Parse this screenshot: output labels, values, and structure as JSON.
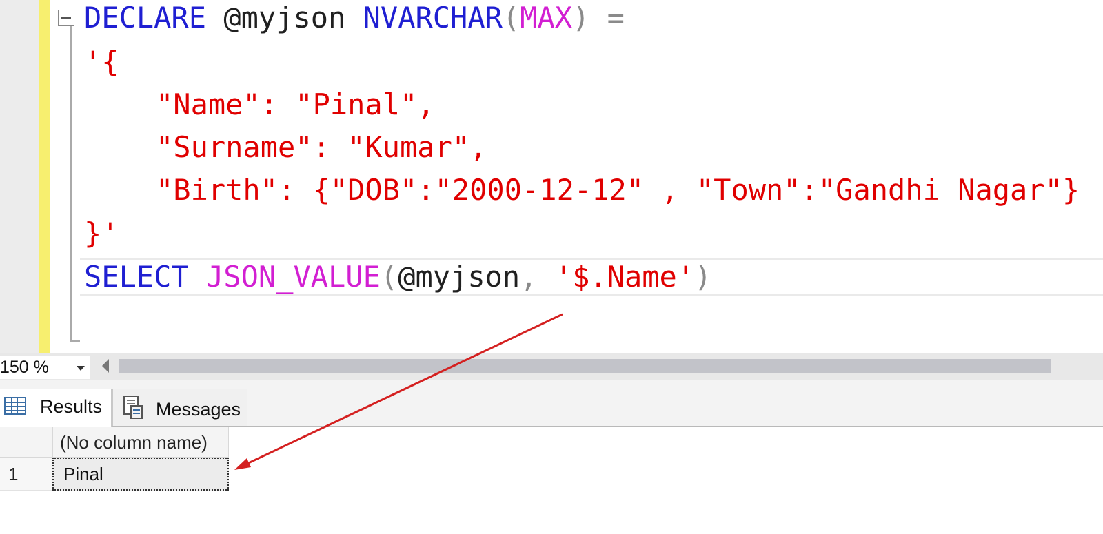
{
  "editor": {
    "lines": {
      "l1": {
        "kw_declare": "DECLARE",
        "var": "@myjson",
        "kw_type": "NVARCHAR",
        "paren_open": "(",
        "fn_max": "MAX",
        "paren_close": ")",
        "equals": "="
      },
      "l2": {
        "text": "'{"
      },
      "l3": {
        "text": "\"Name\": \"Pinal\","
      },
      "l4": {
        "text": "\"Surname\": \"Kumar\","
      },
      "l5": {
        "text": "\"Birth\": {\"DOB\":\"2000-12-12\" , \"Town\":\"Gandhi Nagar\"}"
      },
      "l6": {
        "text": "}'"
      },
      "l7": {
        "kw_select": "SELECT",
        "fn_json_value": "JSON_VALUE",
        "paren_open": "(",
        "var": "@myjson",
        "comma": ",",
        "path": "'$.Name'",
        "paren_close": ")"
      }
    }
  },
  "status": {
    "zoom": "150 %"
  },
  "results": {
    "tabs": {
      "results": "Results",
      "messages": "Messages"
    },
    "column_header": "(No column name)",
    "row_number": "1",
    "cell_value": "Pinal"
  },
  "colors": {
    "keyword": "#1f1fd2",
    "function": "#d21fd2",
    "string": "#e00000",
    "operator": "#8a8a8a",
    "change_bar": "#f7ef6f",
    "annotation_arrow": "#d42020"
  },
  "icons": {
    "collapse": "minus-box-icon",
    "results_tab": "grid-icon",
    "messages_tab": "document-icon",
    "zoom_dropdown": "chevron-down-icon",
    "scroll_left": "scroll-left-icon"
  }
}
